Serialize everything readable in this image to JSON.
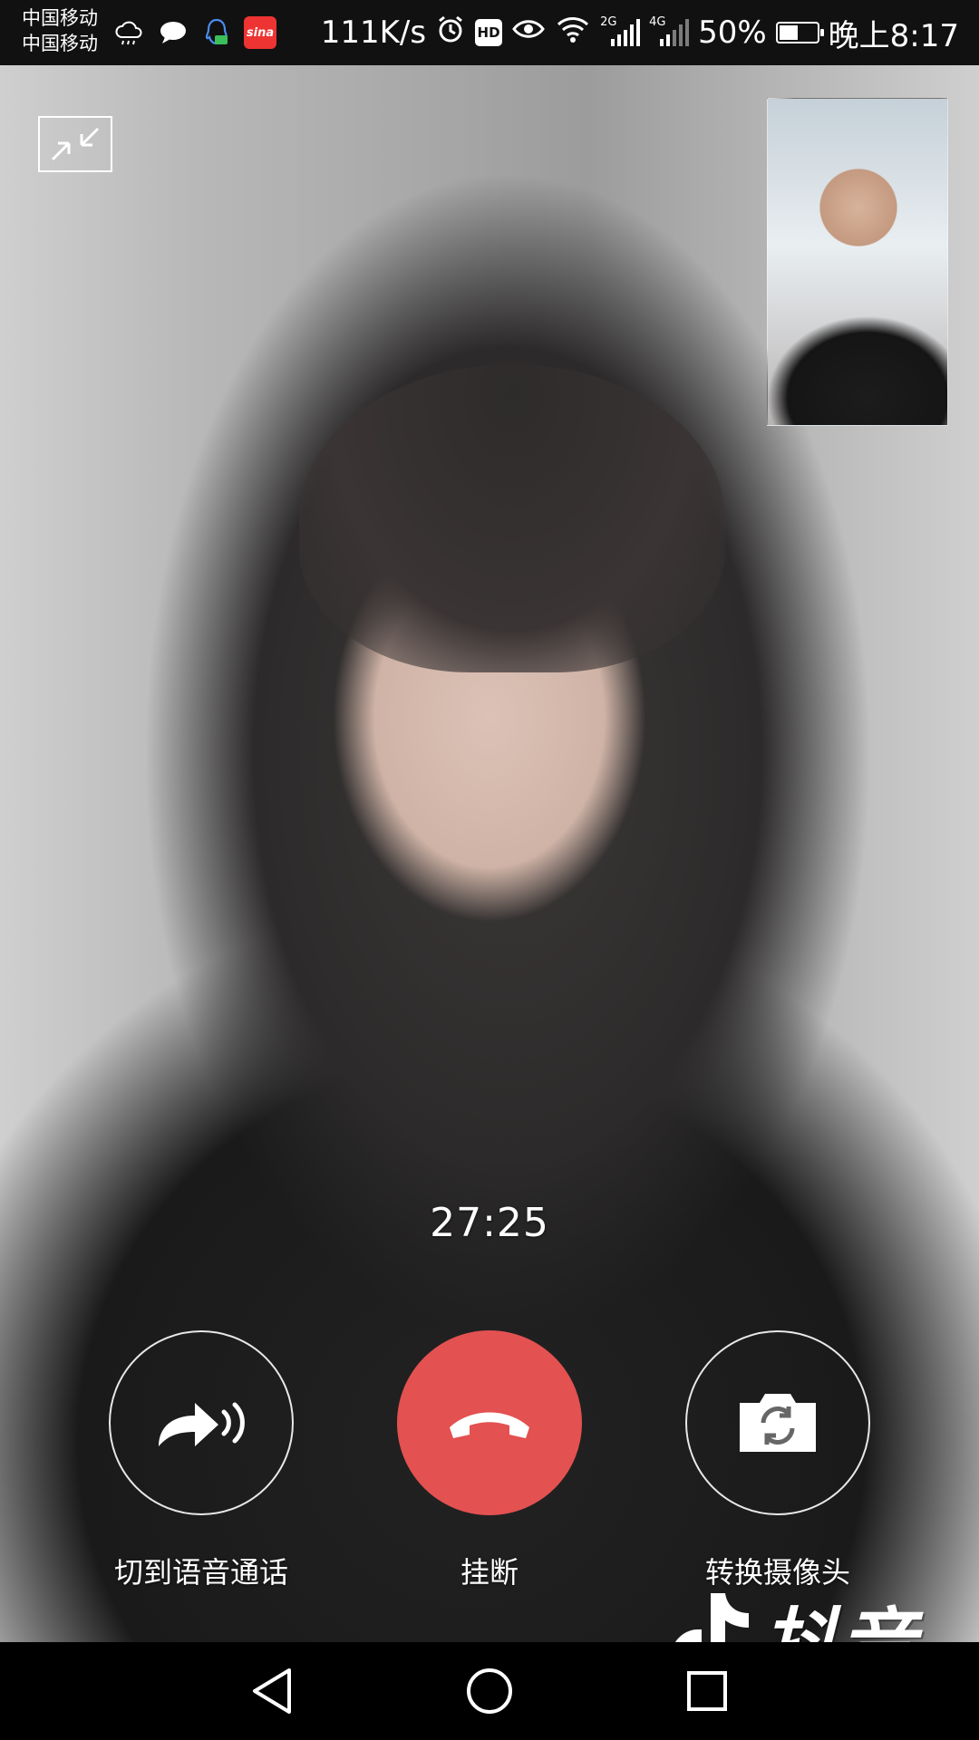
{
  "status_bar": {
    "carrier_1": "中国移动",
    "carrier_2": "中国移动",
    "net_speed": "111K/s",
    "hd_badge": "HD",
    "sig1_tag": "2G",
    "sig2_tag": "4G",
    "battery_percent": "50%",
    "battery_level": 0.5,
    "sina_badge": "sina",
    "time": "晚上8:17"
  },
  "call": {
    "duration": "27:25",
    "switch_voice_label": "切到语音通话",
    "hangup_label": "挂断",
    "switch_camera_label": "转换摄像头",
    "hangup_color": "#e35151"
  },
  "watermark": {
    "brand": "抖音"
  },
  "icons": {
    "minimize": "minimize-window-icon",
    "voice": "voice-call-icon",
    "hangup": "hang-up-icon",
    "camera": "switch-camera-icon",
    "back": "nav-back-icon",
    "home": "nav-home-icon",
    "recents": "nav-recents-icon"
  }
}
